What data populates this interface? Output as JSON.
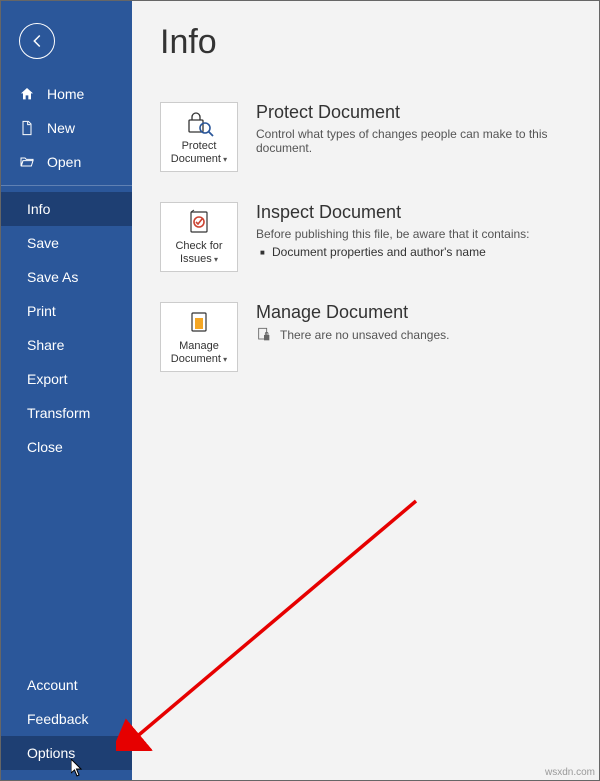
{
  "sidebar": {
    "top": [
      {
        "label": "Home",
        "icon": "home-icon"
      },
      {
        "label": "New",
        "icon": "document-icon"
      },
      {
        "label": "Open",
        "icon": "folder-open-icon"
      }
    ],
    "mid": [
      {
        "label": "Info",
        "selected": true
      },
      {
        "label": "Save"
      },
      {
        "label": "Save As"
      },
      {
        "label": "Print"
      },
      {
        "label": "Share"
      },
      {
        "label": "Export"
      },
      {
        "label": "Transform"
      },
      {
        "label": "Close"
      }
    ],
    "bottom": [
      {
        "label": "Account"
      },
      {
        "label": "Feedback"
      },
      {
        "label": "Options",
        "hovered": true
      }
    ]
  },
  "main": {
    "title": "Info",
    "sections": [
      {
        "tile_label": "Protect Document",
        "title": "Protect Document",
        "desc": "Control what types of changes people can make to this document."
      },
      {
        "tile_label": "Check for Issues",
        "title": "Inspect Document",
        "desc": "Before publishing this file, be aware that it contains:",
        "bullets": [
          "Document properties and author's name"
        ]
      },
      {
        "tile_label": "Manage Document",
        "title": "Manage Document",
        "manage_msg": "There are no unsaved changes."
      }
    ]
  },
  "watermark": "wsxdn.com"
}
